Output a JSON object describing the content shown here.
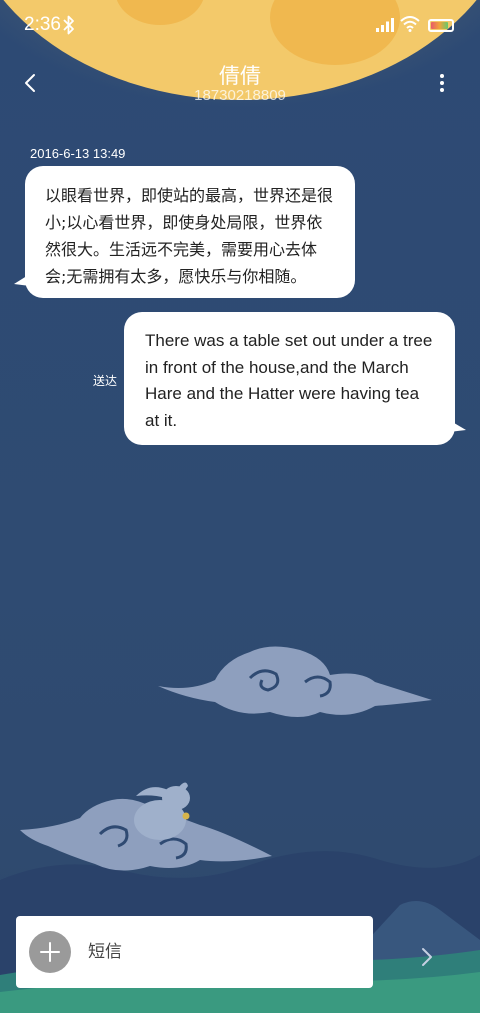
{
  "status_bar": {
    "time": "2:36",
    "bluetooth_icon": "bluetooth-icon",
    "signal_icon": "cellular-signal-icon",
    "wifi_icon": "wifi-icon",
    "battery_icon": "battery-icon",
    "battery_level": 0.85
  },
  "header": {
    "back_icon": "chevron-left-icon",
    "contact_name": "倩倩",
    "contact_number": "18730218809",
    "more_icon": "more-vertical-icon"
  },
  "conversation": {
    "timestamp": "2016-6-13 13:49",
    "messages": [
      {
        "direction": "incoming",
        "lines": [
          "以眼看世界，即使站的最高，世界还是很",
          "小;以心看世界，即使身处局限，世界依",
          "然很大。生活远不完美，需要用心去体",
          "会;无需拥有太多，愿快乐与你相随。"
        ]
      },
      {
        "direction": "outgoing",
        "status": "送达",
        "lines": [
          "There was a table set out under a tree",
          "in front of the house,and the March",
          "Hare and the Hatter were having tea",
          "at it."
        ]
      }
    ]
  },
  "compose": {
    "add_icon": "plus-icon",
    "placeholder": "短信",
    "send_icon": "chevron-right-icon"
  },
  "colors": {
    "background": "#2f4a72",
    "moon": "#f3c96a",
    "bubble": "#ffffff",
    "cloud": "#8e9fbe"
  }
}
